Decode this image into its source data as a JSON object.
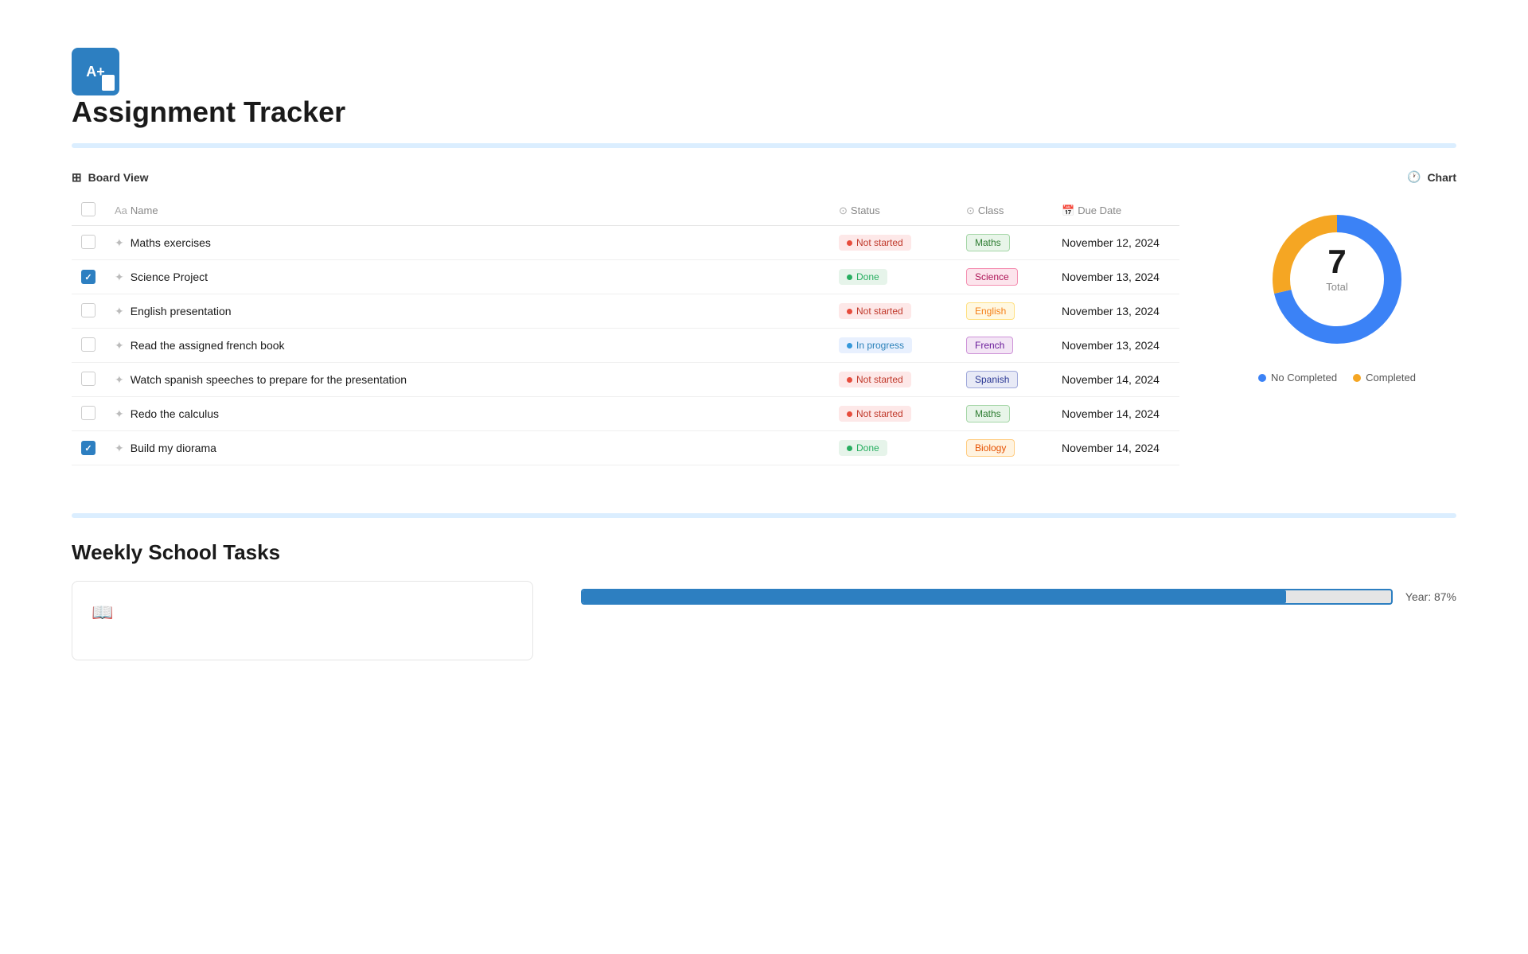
{
  "header": {
    "logo_text": "A+",
    "title": "Assignment Tracker"
  },
  "board_view": {
    "label": "Board View",
    "chart_label": "Chart",
    "columns": {
      "name": "Name",
      "status": "Status",
      "class": "Class",
      "due_date": "Due Date"
    },
    "rows": [
      {
        "id": 1,
        "checked": false,
        "name": "Maths exercises",
        "status": "Not started",
        "status_type": "not-started",
        "class": "Maths",
        "class_type": "maths",
        "due_date": "November 12, 2024"
      },
      {
        "id": 2,
        "checked": true,
        "name": "Science Project",
        "status": "Done",
        "status_type": "done",
        "class": "Science",
        "class_type": "science",
        "due_date": "November 13, 2024"
      },
      {
        "id": 3,
        "checked": false,
        "name": "English presentation",
        "status": "Not started",
        "status_type": "not-started",
        "class": "English",
        "class_type": "english",
        "due_date": "November 13, 2024"
      },
      {
        "id": 4,
        "checked": false,
        "name": "Read the assigned french book",
        "status": "In progress",
        "status_type": "in-progress",
        "class": "French",
        "class_type": "french",
        "due_date": "November 13, 2024"
      },
      {
        "id": 5,
        "checked": false,
        "name": "Watch spanish speeches to prepare for the presentation",
        "status": "Not started",
        "status_type": "not-started",
        "class": "Spanish",
        "class_type": "spanish",
        "due_date": "November 14, 2024"
      },
      {
        "id": 6,
        "checked": false,
        "name": "Redo the calculus",
        "status": "Not started",
        "status_type": "not-started",
        "class": "Maths",
        "class_type": "maths",
        "due_date": "November 14, 2024"
      },
      {
        "id": 7,
        "checked": true,
        "name": "Build my diorama",
        "status": "Done",
        "status_type": "done",
        "class": "Biology",
        "class_type": "biology",
        "due_date": "November 14, 2024"
      }
    ],
    "chart": {
      "total": 7,
      "total_label": "Total",
      "no_completed_value": 5,
      "completed_value": 2,
      "no_completed_pct": 71,
      "completed_pct": 29,
      "legend": {
        "no_completed": "No Completed",
        "completed": "Completed"
      }
    }
  },
  "weekly": {
    "title": "Weekly School Tasks",
    "book_icon": "📖",
    "progress_label": "Year: 87%",
    "progress_pct": 87
  }
}
